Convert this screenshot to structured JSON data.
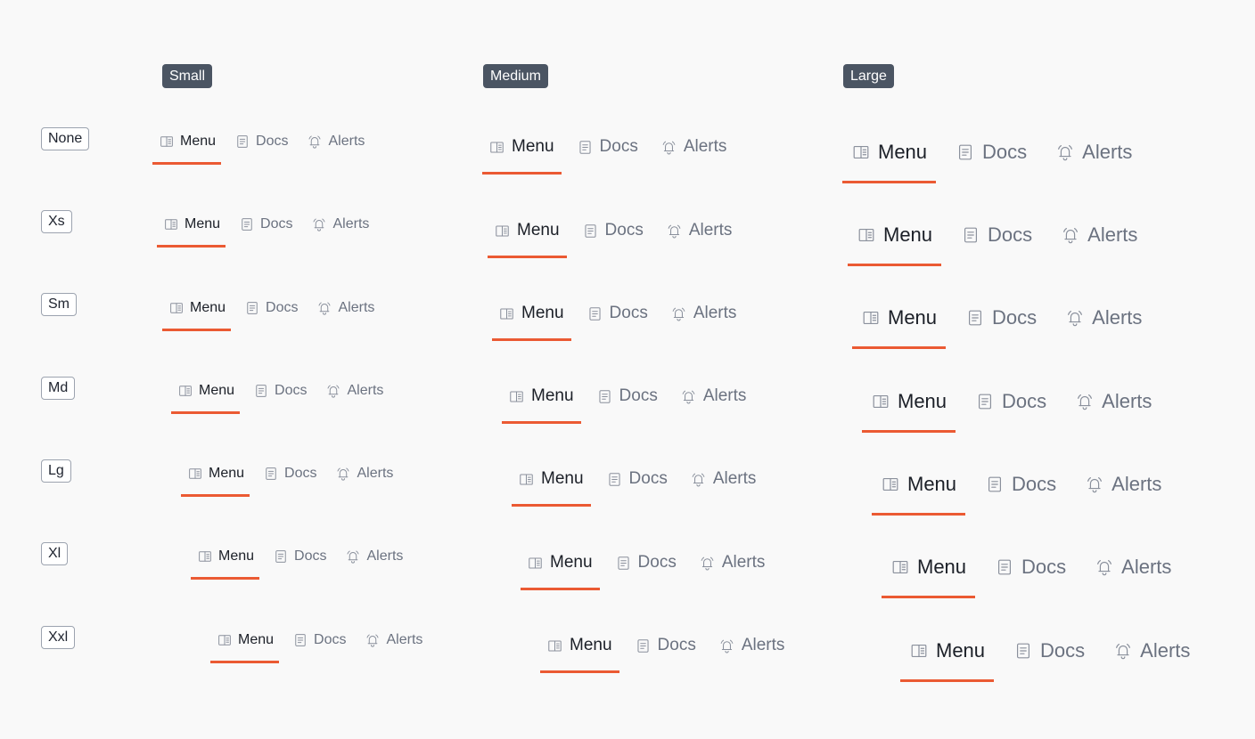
{
  "columns": [
    "Small",
    "Medium",
    "Large"
  ],
  "rows": [
    "None",
    "Xs",
    "Sm",
    "Md",
    "Lg",
    "Xl",
    "Xxl"
  ],
  "tabs": [
    {
      "label": "Menu",
      "icon": "book-open-icon"
    },
    {
      "label": "Docs",
      "icon": "document-icon"
    },
    {
      "label": "Alerts",
      "icon": "bell-ringing-icon"
    }
  ],
  "active_tab": "Menu",
  "colors": {
    "active_indicator": "#eb5a33",
    "header_bg": "#4b5563",
    "inactive_text": "#6b7280",
    "active_text": "#1b1f27"
  }
}
